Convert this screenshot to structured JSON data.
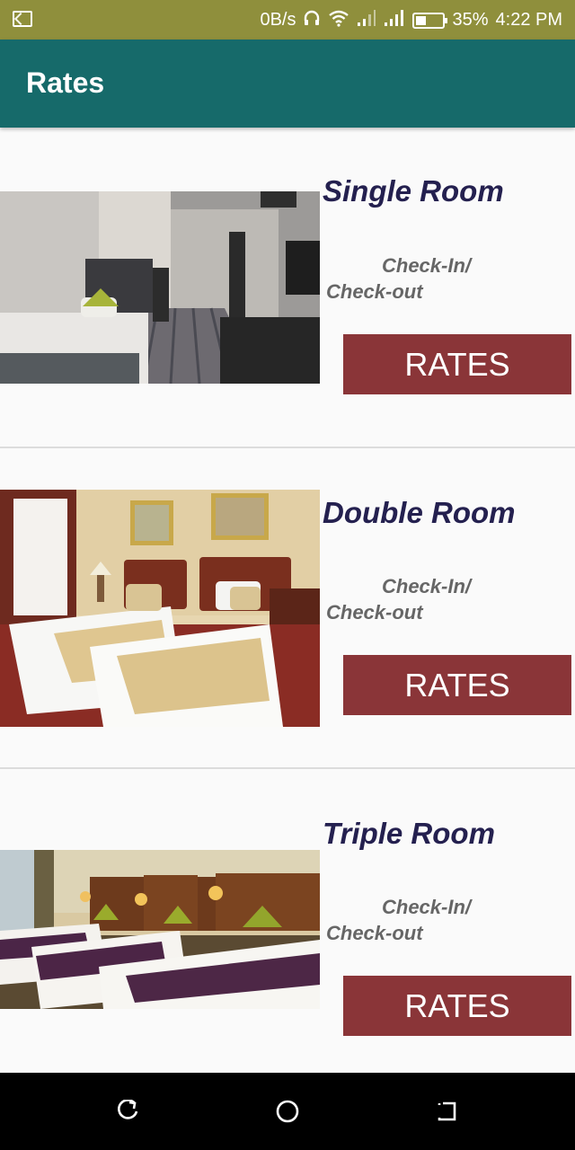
{
  "status_bar": {
    "net_speed": "0B/s",
    "battery": "35%",
    "time": "4:22 PM",
    "icons": [
      "cast-icon",
      "headphones-icon",
      "wifi-icon",
      "signal-icon",
      "signal-icon",
      "battery-icon"
    ]
  },
  "app_bar": {
    "title": "Rates"
  },
  "rooms": [
    {
      "name": "Single Room",
      "checkin_line1": "Check-In/",
      "checkin_line2": "Check-out",
      "button": "RATES",
      "photo": "single-room-photo"
    },
    {
      "name": "Double Room",
      "checkin_line1": "Check-In/",
      "checkin_line2": "Check-out",
      "button": "RATES",
      "photo": "double-room-photo"
    },
    {
      "name": "Triple Room",
      "checkin_line1": "Check-In/",
      "checkin_line2": "Check-out",
      "button": "RATES",
      "photo": "triple-room-photo"
    }
  ],
  "nav_bar": {
    "icons": [
      "back-icon",
      "home-icon",
      "recent-apps-icon"
    ]
  },
  "colors": {
    "status_bar": "#8f8f3c",
    "app_bar": "#166a6a",
    "room_name": "#24204f",
    "rates_button": "#8a3538"
  }
}
